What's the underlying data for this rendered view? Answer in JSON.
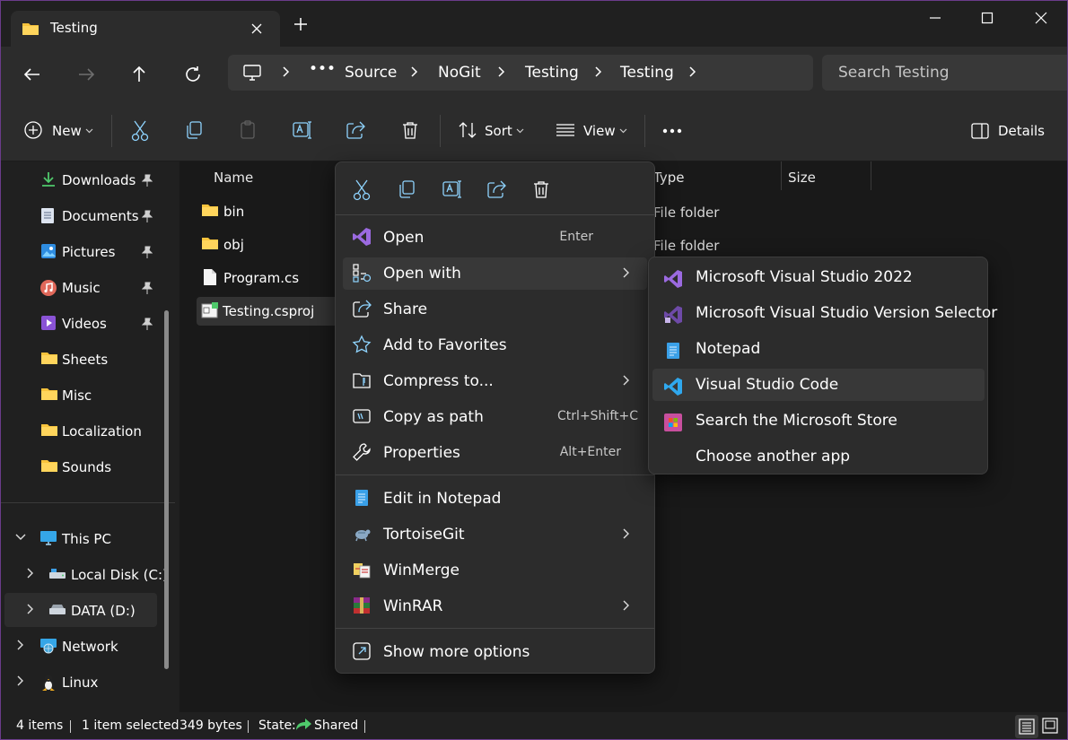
{
  "window": {
    "tab_title": "Testing",
    "accent": "#60cdff",
    "folder_color": "#f8c33c"
  },
  "address": {
    "more": "•••",
    "crumbs": [
      "Source",
      "NoGit",
      "Testing",
      "Testing"
    ],
    "search_placeholder": "Search Testing"
  },
  "toolbar": {
    "new_label": "New",
    "sort_label": "Sort",
    "view_label": "View",
    "details_label": "Details"
  },
  "sidebar": {
    "quick": [
      {
        "label": "Downloads",
        "icon": "download-icon"
      },
      {
        "label": "Documents",
        "icon": "document-icon"
      },
      {
        "label": "Pictures",
        "icon": "pictures-icon"
      },
      {
        "label": "Music",
        "icon": "music-icon"
      },
      {
        "label": "Videos",
        "icon": "video-icon"
      },
      {
        "label": "Sheets",
        "icon": "folder-icon"
      },
      {
        "label": "Misc",
        "icon": "folder-icon"
      },
      {
        "label": "Localization",
        "icon": "folder-icon"
      },
      {
        "label": "Sounds",
        "icon": "folder-icon"
      }
    ],
    "tree": [
      {
        "label": "This PC",
        "icon": "monitor-icon"
      },
      {
        "label": "Local Disk (C:)",
        "icon": "drive-icon"
      },
      {
        "label": "DATA (D:)",
        "icon": "drive-icon"
      },
      {
        "label": "Network",
        "icon": "network-icon"
      },
      {
        "label": "Linux",
        "icon": "linux-icon"
      }
    ]
  },
  "files": {
    "columns": [
      "Name",
      "Type",
      "Size"
    ],
    "rows": [
      {
        "name": "bin",
        "type": "File folder"
      },
      {
        "name": "obj",
        "type": "File folder"
      },
      {
        "name": "Program.cs",
        "type": ""
      },
      {
        "name": "Testing.csproj",
        "type": ""
      }
    ]
  },
  "context_menu": {
    "items": [
      {
        "label": "Open",
        "shortcut": "Enter"
      },
      {
        "label": "Open with",
        "shortcut": ""
      },
      {
        "label": "Share",
        "shortcut": ""
      },
      {
        "label": "Add to Favorites",
        "shortcut": ""
      },
      {
        "label": "Compress to...",
        "shortcut": ""
      },
      {
        "label": "Copy as path",
        "shortcut": "Ctrl+Shift+C"
      },
      {
        "label": "Properties",
        "shortcut": "Alt+Enter"
      },
      {
        "label": "Edit in Notepad",
        "shortcut": ""
      },
      {
        "label": "TortoiseGit",
        "shortcut": ""
      },
      {
        "label": "WinMerge",
        "shortcut": ""
      },
      {
        "label": "WinRAR",
        "shortcut": ""
      },
      {
        "label": "Show more options",
        "shortcut": ""
      }
    ]
  },
  "submenu": {
    "items": [
      {
        "label": "Microsoft Visual Studio 2022"
      },
      {
        "label": "Microsoft Visual Studio Version Selector"
      },
      {
        "label": "Notepad"
      },
      {
        "label": "Visual Studio Code"
      },
      {
        "label": "Search the Microsoft Store"
      },
      {
        "label": "Choose another app"
      }
    ]
  },
  "status": {
    "items_count": "4 items",
    "selected": "1 item selected",
    "size": "349 bytes",
    "state_label": "State:",
    "state_value": "Shared"
  }
}
